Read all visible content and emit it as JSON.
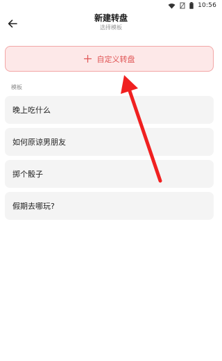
{
  "status_bar": {
    "time": "10:56",
    "icons": [
      "wifi-icon",
      "no-sim-icon",
      "battery-icon"
    ]
  },
  "header": {
    "title": "新建转盘",
    "subtitle": "选择模板",
    "back_icon": "arrow-left-icon"
  },
  "custom": {
    "icon": "plus-icon",
    "label": "自定义转盘",
    "accent_color": "#e05555",
    "bg_color": "#fde8e8"
  },
  "templates": {
    "section_label": "模板",
    "items": [
      {
        "label": "晚上吃什么"
      },
      {
        "label": "如何原谅男朋友"
      },
      {
        "label": "掷个骰子"
      },
      {
        "label": "假期去哪玩?"
      }
    ]
  },
  "annotation": {
    "color": "#f02020"
  }
}
